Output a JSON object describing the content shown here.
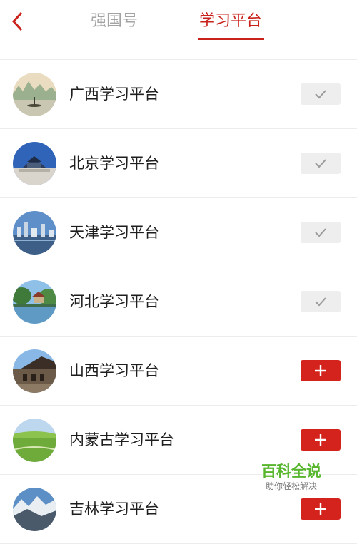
{
  "header": {
    "tabs": [
      {
        "label": "强国号",
        "active": false
      },
      {
        "label": "学习平台",
        "active": true
      }
    ],
    "accent_color": "#c8221a"
  },
  "platforms": [
    {
      "label": "广西学习平台",
      "subscribed": true
    },
    {
      "label": "北京学习平台",
      "subscribed": true
    },
    {
      "label": "天津学习平台",
      "subscribed": true
    },
    {
      "label": "河北学习平台",
      "subscribed": true
    },
    {
      "label": "山西学习平台",
      "subscribed": false
    },
    {
      "label": "内蒙古学习平台",
      "subscribed": false
    },
    {
      "label": "吉林学习平台",
      "subscribed": false
    }
  ],
  "icons": {
    "back": "chevron-left-icon",
    "subscribed": "check-icon",
    "add": "plus-icon"
  },
  "watermark": {
    "title": "百科全说",
    "subtitle": "助你轻松解决"
  }
}
